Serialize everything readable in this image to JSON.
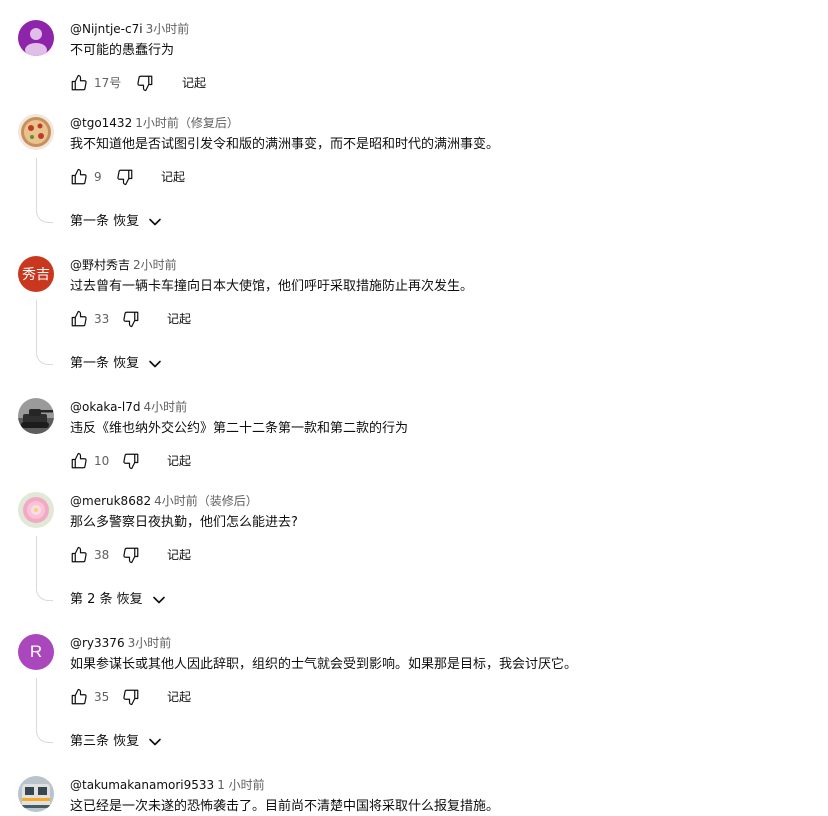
{
  "comments": [
    {
      "author": "@Nijntje-c7i",
      "time": "3小时前",
      "text": "不可能的愚蠢行为",
      "likes": "17号",
      "reply": "记起",
      "replies": "",
      "avatar": "user-silhouette",
      "avatar_bg": "#8e24aa"
    },
    {
      "author": "@tgo1432",
      "time": "1小时前（修复后）",
      "text": "我不知道他是否试图引发令和版的满洲事变，而不是昭和时代的满洲事变。",
      "likes": "9",
      "reply": "记起",
      "replies": "第一条 恢复",
      "avatar": "pizza-photo",
      "avatar_bg": "#c98f5a"
    },
    {
      "author": "@野村秀吉",
      "time": "2小时前",
      "text": "过去曾有一辆卡车撞向日本大使馆，他们呼吁采取措施防止再次发生。",
      "likes": "33",
      "reply": "记起",
      "replies": "第一条 恢复",
      "avatar": "秀吉",
      "avatar_bg": "#c9381e"
    },
    {
      "author": "@okaka-l7d",
      "time": "4小时前",
      "text": "违反《维也纳外交公约》第二十二条第一款和第二款的行为",
      "likes": "10",
      "reply": "记起",
      "replies": "",
      "avatar": "tank-photo",
      "avatar_bg": "#4a4a4a"
    },
    {
      "author": "@meruk8682",
      "time": "4小时前（装修后）",
      "text": "那么多警察日夜执勤，他们怎么能进去?",
      "likes": "38",
      "reply": "记起",
      "replies": "第 2 条 恢复",
      "avatar": "flower-photo",
      "avatar_bg": "#f3c6d8"
    },
    {
      "author": "@ry3376",
      "time": "3小时前",
      "text": "如果参谋长或其他人因此辞职，组织的士气就会受到影响。如果那是目标，我会讨厌它。",
      "likes": "35",
      "reply": "记起",
      "replies": "第三条 恢复",
      "avatar": "R",
      "avatar_bg": "#ab47bc"
    },
    {
      "author": "@takumakanamori9533",
      "time": "1 小时前",
      "text": "这已经是一次未遂的恐怖袭击了。目前尚不清楚中国将采取什么报复措施。",
      "likes": "",
      "reply": "",
      "replies": "",
      "avatar": "train-photo",
      "avatar_bg": "#7b8794"
    }
  ]
}
